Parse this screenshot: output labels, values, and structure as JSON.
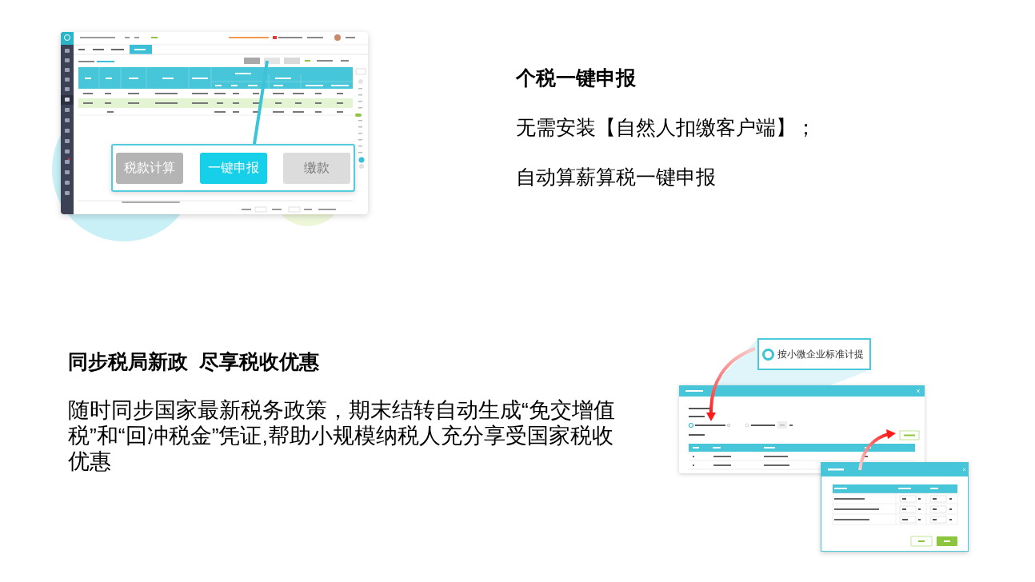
{
  "feature_tax_filing": {
    "title": "个税一键申报",
    "lines": [
      "无需安装【自然人扣缴客户端】；",
      "自动算薪算税一键申报"
    ],
    "callout_buttons": [
      {
        "label": "税款计算",
        "kind": "secondary"
      },
      {
        "label": "一键申报",
        "kind": "primary"
      },
      {
        "label": "缴款",
        "kind": "disabled"
      }
    ]
  },
  "feature_policy": {
    "title": "同步税局新政  尽享税收优惠",
    "body": "随时同步国家最新税务政策，期末结转自动生成“免交增值税”和“回冲税金”凭证,帮助小规模纳税人充分享受国家税收优惠",
    "callout": {
      "label": "按小微企业标准计提",
      "selected": true
    }
  }
}
